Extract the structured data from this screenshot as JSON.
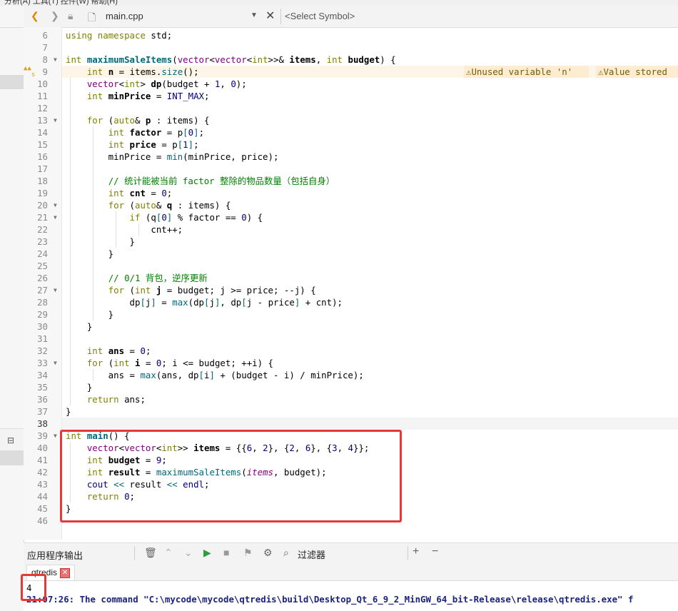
{
  "menubar": {
    "text": "分析(A)    工具(T)    控件(W)    帮助(H)"
  },
  "toolbar": {
    "file_name": "main.cpp",
    "symbol_placeholder": "<Select Symbol>"
  },
  "warnings": {
    "unused": "⚠Unused variable 'n'",
    "value": "⚠Value stored"
  },
  "output_panel": {
    "title": "应用程序输出",
    "filter_label": "过滤器",
    "tab_label": "qtredis",
    "output_value": "4",
    "command_line": "21:07:26: The command \"C:\\mycode\\mycode\\qtredis\\build\\Desktop_Qt_6_9_2_MinGW_64_bit-Release\\release\\qtredis.exe\" f"
  },
  "code_lines": [
    {
      "n": "6",
      "tokens": [
        [
          "kw",
          "using"
        ],
        [
          "",
          ""
        ],
        [
          "kw",
          " namespace"
        ],
        [
          "",
          " std;"
        ]
      ]
    },
    {
      "n": "7",
      "tokens": []
    },
    {
      "n": "8",
      "fold": true,
      "tokens": [
        [
          "kw",
          "int"
        ],
        [
          "",
          " "
        ],
        [
          "fn b",
          "maximumSaleItems"
        ],
        [
          "",
          "("
        ],
        [
          "ty",
          "vector"
        ],
        [
          "",
          "<"
        ],
        [
          "ty",
          "vector"
        ],
        [
          "",
          "<"
        ],
        [
          "kw",
          "int"
        ],
        [
          "",
          ">>& "
        ],
        [
          "b",
          "items"
        ],
        [
          "",
          ", "
        ],
        [
          "kw",
          "int"
        ],
        [
          "",
          " "
        ],
        [
          "b",
          "budget"
        ],
        [
          "",
          ") {"
        ]
      ]
    },
    {
      "n": "9",
      "warn": true,
      "tokens": [
        [
          "",
          "    "
        ],
        [
          "kw",
          "int"
        ],
        [
          "",
          " "
        ],
        [
          "b",
          "n"
        ],
        [
          "",
          " = items."
        ],
        [
          "fn",
          "size"
        ],
        [
          "",
          "();"
        ]
      ]
    },
    {
      "n": "10",
      "tokens": [
        [
          "",
          "    "
        ],
        [
          "ty",
          "vector"
        ],
        [
          "",
          "<"
        ],
        [
          "kw",
          "int"
        ],
        [
          "",
          "> "
        ],
        [
          "b",
          "dp"
        ],
        [
          "",
          "(budget + "
        ],
        [
          "num",
          "1"
        ],
        [
          "",
          ", "
        ],
        [
          "num",
          "0"
        ],
        [
          "",
          ");"
        ]
      ]
    },
    {
      "n": "11",
      "tokens": [
        [
          "",
          "    "
        ],
        [
          "kw",
          "int"
        ],
        [
          "",
          " "
        ],
        [
          "b",
          "minPrice"
        ],
        [
          "",
          " = "
        ],
        [
          "mac",
          "INT_MAX"
        ],
        [
          "",
          ";"
        ]
      ]
    },
    {
      "n": "12",
      "tokens": []
    },
    {
      "n": "13",
      "fold": true,
      "tokens": [
        [
          "",
          "    "
        ],
        [
          "kw",
          "for"
        ],
        [
          "",
          " ("
        ],
        [
          "kw",
          "auto"
        ],
        [
          "",
          "& "
        ],
        [
          "b",
          "p"
        ],
        [
          "",
          " : items) {"
        ]
      ]
    },
    {
      "n": "14",
      "tokens": [
        [
          "",
          "        "
        ],
        [
          "kw",
          "int"
        ],
        [
          "",
          " "
        ],
        [
          "b",
          "factor"
        ],
        [
          "",
          " = p"
        ],
        [
          "fn",
          "["
        ],
        [
          "num",
          "0"
        ],
        [
          "fn",
          "]"
        ],
        [
          "",
          ";"
        ]
      ]
    },
    {
      "n": "15",
      "tokens": [
        [
          "",
          "        "
        ],
        [
          "kw",
          "int"
        ],
        [
          "",
          " "
        ],
        [
          "b",
          "price"
        ],
        [
          "",
          " = p"
        ],
        [
          "fn",
          "["
        ],
        [
          "num",
          "1"
        ],
        [
          "fn",
          "]"
        ],
        [
          "",
          ";"
        ]
      ]
    },
    {
      "n": "16",
      "tokens": [
        [
          "",
          "        minPrice = "
        ],
        [
          "fn",
          "min"
        ],
        [
          "",
          "(minPrice, price);"
        ]
      ]
    },
    {
      "n": "17",
      "tokens": []
    },
    {
      "n": "18",
      "tokens": [
        [
          "",
          "        "
        ],
        [
          "cm",
          "// 统计能被当前 factor 整除的物品数量（包括自身）"
        ]
      ]
    },
    {
      "n": "19",
      "tokens": [
        [
          "",
          "        "
        ],
        [
          "kw",
          "int"
        ],
        [
          "",
          " "
        ],
        [
          "b",
          "cnt"
        ],
        [
          "",
          " = "
        ],
        [
          "num",
          "0"
        ],
        [
          "",
          ";"
        ]
      ]
    },
    {
      "n": "20",
      "fold": true,
      "tokens": [
        [
          "",
          "        "
        ],
        [
          "kw",
          "for"
        ],
        [
          "",
          " ("
        ],
        [
          "kw",
          "auto"
        ],
        [
          "",
          "& "
        ],
        [
          "b",
          "q"
        ],
        [
          "",
          " : items) {"
        ]
      ]
    },
    {
      "n": "21",
      "fold": true,
      "tokens": [
        [
          "",
          "            "
        ],
        [
          "kw",
          "if"
        ],
        [
          "",
          " (q"
        ],
        [
          "fn",
          "["
        ],
        [
          "num",
          "0"
        ],
        [
          "fn",
          "]"
        ],
        [
          "",
          " % factor == "
        ],
        [
          "num",
          "0"
        ],
        [
          "",
          ") {"
        ]
      ]
    },
    {
      "n": "22",
      "tokens": [
        [
          "",
          "                cnt++;"
        ]
      ]
    },
    {
      "n": "23",
      "tokens": [
        [
          "",
          "            }"
        ]
      ]
    },
    {
      "n": "24",
      "tokens": [
        [
          "",
          "        }"
        ]
      ]
    },
    {
      "n": "25",
      "tokens": []
    },
    {
      "n": "26",
      "tokens": [
        [
          "",
          "        "
        ],
        [
          "cm",
          "// 0/1 背包，逆序更新"
        ]
      ]
    },
    {
      "n": "27",
      "fold": true,
      "tokens": [
        [
          "",
          "        "
        ],
        [
          "kw",
          "for"
        ],
        [
          "",
          " ("
        ],
        [
          "kw",
          "int"
        ],
        [
          "",
          " "
        ],
        [
          "b",
          "j"
        ],
        [
          "",
          " = budget; j >= price; --j) {"
        ]
      ]
    },
    {
      "n": "28",
      "tokens": [
        [
          "",
          "            dp"
        ],
        [
          "fn",
          "["
        ],
        [
          "",
          "j"
        ],
        [
          "fn",
          "]"
        ],
        [
          "",
          " = "
        ],
        [
          "fn",
          "max"
        ],
        [
          "",
          "(dp"
        ],
        [
          "fn",
          "["
        ],
        [
          "",
          "j"
        ],
        [
          "fn",
          "]"
        ],
        [
          "",
          ", dp"
        ],
        [
          "fn",
          "["
        ],
        [
          "",
          "j - price"
        ],
        [
          "fn",
          "]"
        ],
        [
          "",
          " + cnt);"
        ]
      ]
    },
    {
      "n": "29",
      "tokens": [
        [
          "",
          "        }"
        ]
      ]
    },
    {
      "n": "30",
      "tokens": [
        [
          "",
          "    }"
        ]
      ]
    },
    {
      "n": "31",
      "tokens": []
    },
    {
      "n": "32",
      "tokens": [
        [
          "",
          "    "
        ],
        [
          "kw",
          "int"
        ],
        [
          "",
          " "
        ],
        [
          "b",
          "ans"
        ],
        [
          "",
          " = "
        ],
        [
          "num",
          "0"
        ],
        [
          "",
          ";"
        ]
      ]
    },
    {
      "n": "33",
      "fold": true,
      "tokens": [
        [
          "",
          "    "
        ],
        [
          "kw",
          "for"
        ],
        [
          "",
          " ("
        ],
        [
          "kw",
          "int"
        ],
        [
          "",
          " "
        ],
        [
          "b",
          "i"
        ],
        [
          "",
          " = "
        ],
        [
          "num",
          "0"
        ],
        [
          "",
          "; i <= budget; ++i) {"
        ]
      ]
    },
    {
      "n": "34",
      "tokens": [
        [
          "",
          "        ans = "
        ],
        [
          "fn",
          "max"
        ],
        [
          "",
          "(ans, dp"
        ],
        [
          "fn",
          "["
        ],
        [
          "",
          "i"
        ],
        [
          "fn",
          "]"
        ],
        [
          "",
          " + (budget - i) / minPrice);"
        ]
      ]
    },
    {
      "n": "35",
      "tokens": [
        [
          "",
          "    }"
        ]
      ]
    },
    {
      "n": "36",
      "tokens": [
        [
          "",
          "    "
        ],
        [
          "kw",
          "return"
        ],
        [
          "",
          " ans;"
        ]
      ]
    },
    {
      "n": "37",
      "tokens": [
        [
          "",
          "}"
        ]
      ]
    },
    {
      "n": "38",
      "cur": true,
      "tokens": []
    },
    {
      "n": "39",
      "fold": true,
      "tokens": [
        [
          "kw",
          "int"
        ],
        [
          "",
          " "
        ],
        [
          "fn b",
          "main"
        ],
        [
          "",
          "() {"
        ]
      ]
    },
    {
      "n": "40",
      "tokens": [
        [
          "",
          "    "
        ],
        [
          "ty",
          "vector"
        ],
        [
          "",
          "<"
        ],
        [
          "ty",
          "vector"
        ],
        [
          "",
          "<"
        ],
        [
          "kw",
          "int"
        ],
        [
          "",
          ">> "
        ],
        [
          "b",
          "items"
        ],
        [
          "",
          " = {{"
        ],
        [
          "num",
          "6"
        ],
        [
          "",
          ", "
        ],
        [
          "num",
          "2"
        ],
        [
          "",
          "}, {"
        ],
        [
          "num",
          "2"
        ],
        [
          "",
          ", "
        ],
        [
          "num",
          "6"
        ],
        [
          "",
          "}, {"
        ],
        [
          "num",
          "3"
        ],
        [
          "",
          ", "
        ],
        [
          "num",
          "4"
        ],
        [
          "",
          "}};"
        ]
      ]
    },
    {
      "n": "41",
      "tokens": [
        [
          "",
          "    "
        ],
        [
          "kw",
          "int"
        ],
        [
          "",
          " "
        ],
        [
          "b",
          "budget"
        ],
        [
          "",
          " = "
        ],
        [
          "num",
          "9"
        ],
        [
          "",
          ";"
        ]
      ]
    },
    {
      "n": "42",
      "tokens": [
        [
          "",
          "    "
        ],
        [
          "kw",
          "int"
        ],
        [
          "",
          " "
        ],
        [
          "b",
          "result"
        ],
        [
          "",
          " = "
        ],
        [
          "fn",
          "maximumSaleItems"
        ],
        [
          "",
          "("
        ],
        [
          "ty it",
          "items"
        ],
        [
          "",
          ", budget);"
        ]
      ]
    },
    {
      "n": "43",
      "tokens": [
        [
          "",
          "    "
        ],
        [
          "mac",
          "cout"
        ],
        [
          "",
          " "
        ],
        [
          "fn",
          "<<"
        ],
        [
          "",
          " result "
        ],
        [
          "fn",
          "<<"
        ],
        [
          "",
          " "
        ],
        [
          "mac",
          "endl"
        ],
        [
          "",
          ";"
        ]
      ]
    },
    {
      "n": "44",
      "tokens": [
        [
          "",
          "    "
        ],
        [
          "kw",
          "return"
        ],
        [
          "",
          " "
        ],
        [
          "num",
          "0"
        ],
        [
          "",
          ";"
        ]
      ]
    },
    {
      "n": "45",
      "tokens": [
        [
          "",
          "}"
        ]
      ]
    },
    {
      "n": "46",
      "tokens": []
    }
  ]
}
